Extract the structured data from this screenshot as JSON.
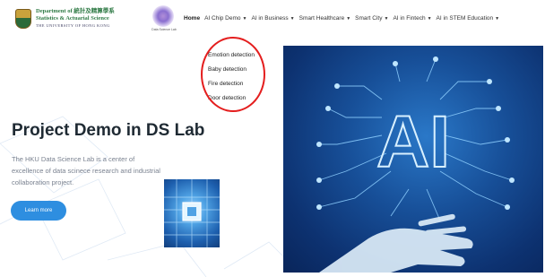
{
  "header": {
    "department": {
      "line1": "Department of 統計及精算學系",
      "line2": "Statistics & Actuarial Science",
      "line3": "THE UNIVERSITY OF HONG KONG"
    },
    "lab_logo_caption": "Data Science Lab"
  },
  "nav": {
    "items": [
      {
        "label": "Home",
        "active": true,
        "has_caret": false
      },
      {
        "label": "AI Chip Demo",
        "active": false,
        "has_caret": true
      },
      {
        "label": "AI in Business",
        "active": false,
        "has_caret": true
      },
      {
        "label": "Smart Healthcare",
        "active": false,
        "has_caret": true
      },
      {
        "label": "Smart City",
        "active": false,
        "has_caret": true
      },
      {
        "label": "AI in Fintech",
        "active": false,
        "has_caret": true
      },
      {
        "label": "AI in STEM Education",
        "active": false,
        "has_caret": true
      }
    ],
    "caret_symbol": "▼"
  },
  "dropdown": {
    "items": [
      "Emotion detection",
      "Baby detection",
      "Fire detection",
      "Door detection"
    ]
  },
  "hero": {
    "title": "Project Demo in DS Lab",
    "description": "The HKU Data Science Lab is a center of excellence of data scinece research and industrial collaboration project.",
    "button_label": "Learn more"
  },
  "images": {
    "ai_illustration_text": "AI"
  },
  "colors": {
    "accent": "#2e8ee0",
    "highlight_circle": "#e41e1e",
    "title": "#1f2a33",
    "department_green": "#2f7a45"
  }
}
